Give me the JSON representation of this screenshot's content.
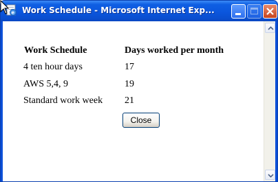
{
  "window": {
    "title": "Work Schedule - Microsoft Internet Exp...",
    "icons": {
      "app": "ie-page-icon",
      "minimize": "minimize-icon",
      "maximize": "maximize-icon",
      "close": "close-icon"
    }
  },
  "table": {
    "headers": [
      "Work Schedule",
      "Days worked per month"
    ],
    "rows": [
      [
        "4 ten hour days",
        "17"
      ],
      [
        "AWS 5,4, 9",
        "19"
      ],
      [
        "Standard work week",
        "21"
      ]
    ]
  },
  "actions": {
    "close_label": "Close"
  },
  "colors": {
    "titlebar": "#0b56dd",
    "close_button": "#c7441d",
    "page_background": "#ffffff"
  }
}
